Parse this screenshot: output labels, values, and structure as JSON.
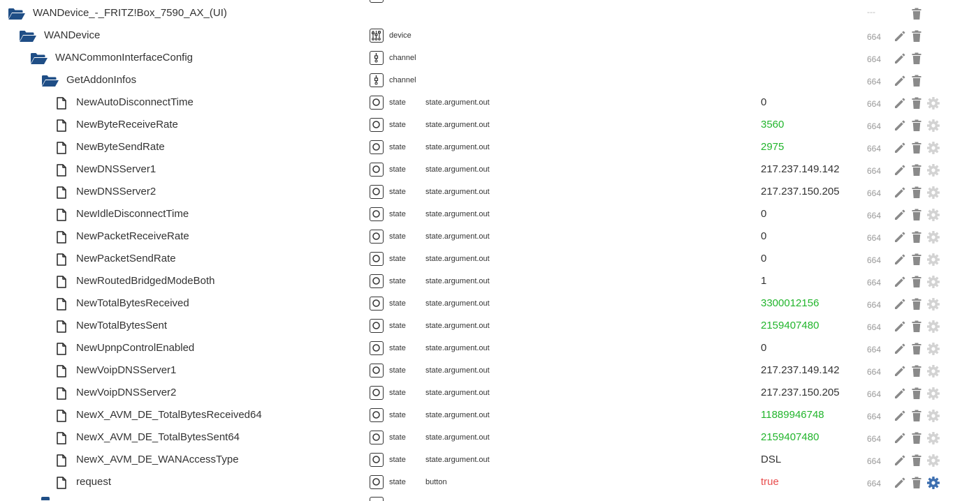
{
  "colors": {
    "folder": "#1f4e86",
    "value_green": "#22b52c",
    "value_red": "#e84d4d",
    "action_gray": "#8a8a8a",
    "settings_gray": "#d3d3d3",
    "settings_active": "#3d6fb0"
  },
  "rows": [
    {
      "kind": "folder",
      "level": 0,
      "name": "WANDevice_-_FRITZ!Box_7590_AX_(UI)",
      "type_icon": "",
      "type": "",
      "role": "",
      "value": "",
      "acl": "---",
      "edit": false,
      "delete": true,
      "settings": "none"
    },
    {
      "kind": "folder",
      "level": 1,
      "name": "WANDevice",
      "type_icon": "device-icon",
      "type": "device",
      "role": "",
      "value": "",
      "acl": "664",
      "edit": true,
      "delete": true,
      "settings": "none"
    },
    {
      "kind": "folder",
      "level": 2,
      "name": "WANCommonInterfaceConfig",
      "type_icon": "channel-icon",
      "type": "channel",
      "role": "",
      "value": "",
      "acl": "664",
      "edit": true,
      "delete": true,
      "settings": "none"
    },
    {
      "kind": "folder",
      "level": 3,
      "name": "GetAddonInfos",
      "type_icon": "channel-icon",
      "type": "channel",
      "role": "",
      "value": "",
      "acl": "664",
      "edit": true,
      "delete": true,
      "settings": "none"
    },
    {
      "kind": "file",
      "level": 4,
      "name": "NewAutoDisconnectTime",
      "type_icon": "state-icon",
      "type": "state",
      "role": "state.argument.out",
      "value": "0",
      "value_color": "default",
      "acl": "664",
      "edit": true,
      "delete": true,
      "settings": "inactive"
    },
    {
      "kind": "file",
      "level": 4,
      "name": "NewByteReceiveRate",
      "type_icon": "state-icon",
      "type": "state",
      "role": "state.argument.out",
      "value": "3560",
      "value_color": "green",
      "acl": "664",
      "edit": true,
      "delete": true,
      "settings": "inactive"
    },
    {
      "kind": "file",
      "level": 4,
      "name": "NewByteSendRate",
      "type_icon": "state-icon",
      "type": "state",
      "role": "state.argument.out",
      "value": "2975",
      "value_color": "green",
      "acl": "664",
      "edit": true,
      "delete": true,
      "settings": "inactive"
    },
    {
      "kind": "file",
      "level": 4,
      "name": "NewDNSServer1",
      "type_icon": "state-icon",
      "type": "state",
      "role": "state.argument.out",
      "value": "217.237.149.142",
      "value_color": "default",
      "acl": "664",
      "edit": true,
      "delete": true,
      "settings": "inactive"
    },
    {
      "kind": "file",
      "level": 4,
      "name": "NewDNSServer2",
      "type_icon": "state-icon",
      "type": "state",
      "role": "state.argument.out",
      "value": "217.237.150.205",
      "value_color": "default",
      "acl": "664",
      "edit": true,
      "delete": true,
      "settings": "inactive"
    },
    {
      "kind": "file",
      "level": 4,
      "name": "NewIdleDisconnectTime",
      "type_icon": "state-icon",
      "type": "state",
      "role": "state.argument.out",
      "value": "0",
      "value_color": "default",
      "acl": "664",
      "edit": true,
      "delete": true,
      "settings": "inactive"
    },
    {
      "kind": "file",
      "level": 4,
      "name": "NewPacketReceiveRate",
      "type_icon": "state-icon",
      "type": "state",
      "role": "state.argument.out",
      "value": "0",
      "value_color": "default",
      "acl": "664",
      "edit": true,
      "delete": true,
      "settings": "inactive"
    },
    {
      "kind": "file",
      "level": 4,
      "name": "NewPacketSendRate",
      "type_icon": "state-icon",
      "type": "state",
      "role": "state.argument.out",
      "value": "0",
      "value_color": "default",
      "acl": "664",
      "edit": true,
      "delete": true,
      "settings": "inactive"
    },
    {
      "kind": "file",
      "level": 4,
      "name": "NewRoutedBridgedModeBoth",
      "type_icon": "state-icon",
      "type": "state",
      "role": "state.argument.out",
      "value": "1",
      "value_color": "default",
      "acl": "664",
      "edit": true,
      "delete": true,
      "settings": "inactive"
    },
    {
      "kind": "file",
      "level": 4,
      "name": "NewTotalBytesReceived",
      "type_icon": "state-icon",
      "type": "state",
      "role": "state.argument.out",
      "value": "3300012156",
      "value_color": "green",
      "acl": "664",
      "edit": true,
      "delete": true,
      "settings": "inactive"
    },
    {
      "kind": "file",
      "level": 4,
      "name": "NewTotalBytesSent",
      "type_icon": "state-icon",
      "type": "state",
      "role": "state.argument.out",
      "value": "2159407480",
      "value_color": "green",
      "acl": "664",
      "edit": true,
      "delete": true,
      "settings": "inactive"
    },
    {
      "kind": "file",
      "level": 4,
      "name": "NewUpnpControlEnabled",
      "type_icon": "state-icon",
      "type": "state",
      "role": "state.argument.out",
      "value": "0",
      "value_color": "default",
      "acl": "664",
      "edit": true,
      "delete": true,
      "settings": "inactive"
    },
    {
      "kind": "file",
      "level": 4,
      "name": "NewVoipDNSServer1",
      "type_icon": "state-icon",
      "type": "state",
      "role": "state.argument.out",
      "value": "217.237.149.142",
      "value_color": "default",
      "acl": "664",
      "edit": true,
      "delete": true,
      "settings": "inactive"
    },
    {
      "kind": "file",
      "level": 4,
      "name": "NewVoipDNSServer2",
      "type_icon": "state-icon",
      "type": "state",
      "role": "state.argument.out",
      "value": "217.237.150.205",
      "value_color": "default",
      "acl": "664",
      "edit": true,
      "delete": true,
      "settings": "inactive"
    },
    {
      "kind": "file",
      "level": 4,
      "name": "NewX_AVM_DE_TotalBytesReceived64",
      "type_icon": "state-icon",
      "type": "state",
      "role": "state.argument.out",
      "value": "11889946748",
      "value_color": "green",
      "acl": "664",
      "edit": true,
      "delete": true,
      "settings": "inactive"
    },
    {
      "kind": "file",
      "level": 4,
      "name": "NewX_AVM_DE_TotalBytesSent64",
      "type_icon": "state-icon",
      "type": "state",
      "role": "state.argument.out",
      "value": "2159407480",
      "value_color": "green",
      "acl": "664",
      "edit": true,
      "delete": true,
      "settings": "inactive"
    },
    {
      "kind": "file",
      "level": 4,
      "name": "NewX_AVM_DE_WANAccessType",
      "type_icon": "state-icon",
      "type": "state",
      "role": "state.argument.out",
      "value": "DSL",
      "value_color": "default",
      "acl": "664",
      "edit": true,
      "delete": true,
      "settings": "inactive"
    },
    {
      "kind": "file",
      "level": 4,
      "name": "request",
      "type_icon": "state-icon",
      "type": "state",
      "role": "button",
      "value": "true",
      "value_color": "red",
      "acl": "664",
      "edit": true,
      "delete": true,
      "settings": "active"
    }
  ]
}
